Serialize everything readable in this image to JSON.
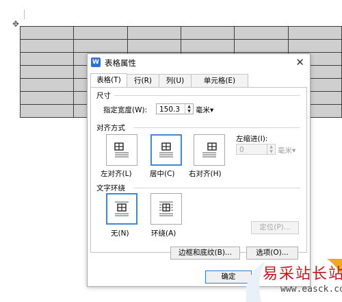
{
  "document": {
    "move_handle_icon": "move-cross-icon",
    "table_rows": 7,
    "table_cols": 6
  },
  "dialog": {
    "app_icon_letter": "W",
    "title": "表格属性",
    "close_glyph": "✕",
    "tabs": [
      {
        "label": "表格(T)",
        "active": true
      },
      {
        "label": "行(R)",
        "active": false
      },
      {
        "label": "列(U)",
        "active": false
      },
      {
        "label": "单元格(E)",
        "active": false
      }
    ],
    "size_section": "尺寸",
    "width_label": "指定宽度(W):",
    "width_value": "150.3",
    "width_unit": "毫米▾",
    "align_section": "对齐方式",
    "align_options": [
      {
        "label": "左对齐(L)",
        "icon": "align-left-icon",
        "selected": false
      },
      {
        "label": "居中(C)",
        "icon": "align-center-icon",
        "selected": true
      },
      {
        "label": "右对齐(H)",
        "icon": "align-right-icon",
        "selected": false
      }
    ],
    "indent_label": "左缩进(I):",
    "indent_value": "0",
    "indent_unit": "毫米▾",
    "wrap_section": "文字环绕",
    "wrap_options": [
      {
        "label": "无(N)",
        "icon": "wrap-none-icon",
        "selected": true
      },
      {
        "label": "环绕(A)",
        "icon": "wrap-around-icon",
        "selected": false
      }
    ],
    "position_button": "定位(P)...",
    "borders_button": "边框和底纹(B)...",
    "options_button": "选项(O)...",
    "ok_button": "确定"
  },
  "watermark": {
    "text": "易采站长站",
    "url": "www.easck.com"
  },
  "colors": {
    "accent": "#3b8ad8",
    "table_fill": "#cfcfcf",
    "watermark_red": "#c9141c"
  }
}
